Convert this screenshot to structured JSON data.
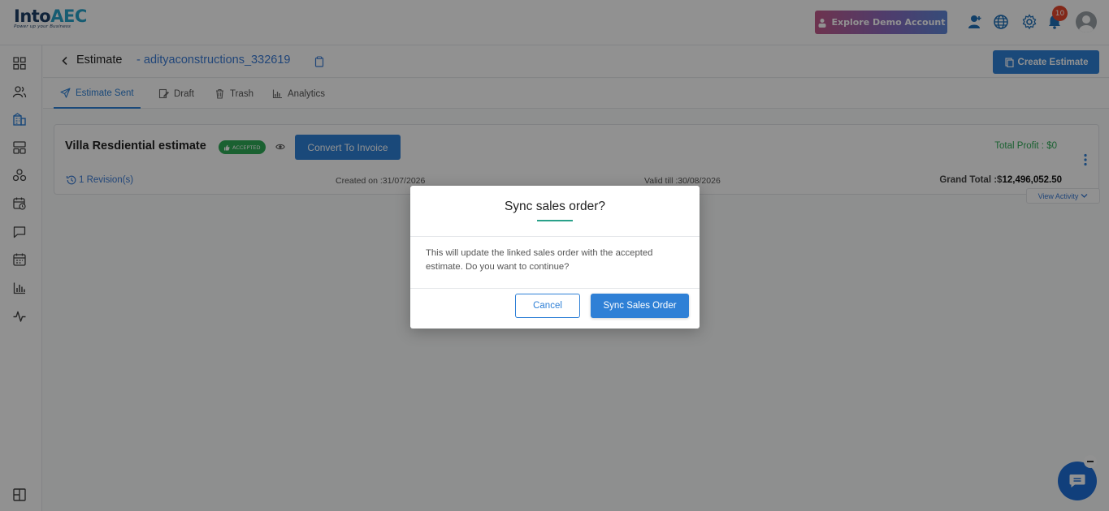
{
  "brand": {
    "logo_prefix": "Into",
    "logo_suffix": "AEC",
    "tagline": "Power up your Business"
  },
  "topbar": {
    "demo_label": "Explore Demo Account",
    "notification_count": "10",
    "icons": [
      "add-user-icon",
      "globe-icon",
      "settings-icon",
      "bell-icon",
      "avatar"
    ]
  },
  "sidebar": {
    "items": [
      "dashboard-icon",
      "users-icon",
      "building-icon",
      "layout-icon",
      "network-icon",
      "calendar-clock-icon",
      "chat-icon",
      "calendar-icon",
      "bar-chart-icon",
      "activity-icon",
      "panel-toggle-icon"
    ]
  },
  "header": {
    "title": "Estimate",
    "separator": "-",
    "company": "adityaconstructions_332619",
    "create_label": "Create Estimate"
  },
  "tabs": [
    {
      "label": "Estimate Sent",
      "icon": "send-icon",
      "active": true
    },
    {
      "label": "Draft",
      "icon": "edit-icon",
      "active": false
    },
    {
      "label": "Trash",
      "icon": "trash-icon",
      "active": false
    },
    {
      "label": "Analytics",
      "icon": "bar-chart-icon",
      "active": false
    }
  ],
  "estimate": {
    "title": "Villa Resdiential estimate",
    "status": "ACCEPTED",
    "convert_label": "Convert To Invoice",
    "total_profit": "Total Profit : $0",
    "revisions": "1 Revision(s)",
    "created_on": "Created on :31/07/2026",
    "valid_till": "Valid till :30/08/2026",
    "grand_total_label": "Grand Total :$",
    "grand_total_value": "12,496,052.50",
    "view_activity": "View Activity"
  },
  "modal": {
    "title": "Sync sales order?",
    "body": "This will update the linked sales order with the accepted estimate. Do you want to continue?",
    "cancel_label": "Cancel",
    "confirm_label": "Sync Sales Order"
  },
  "colors": {
    "primary": "#2f80d6",
    "success": "#2fab56",
    "danger": "#e4472d",
    "accent_underline": "#2aa18a"
  }
}
